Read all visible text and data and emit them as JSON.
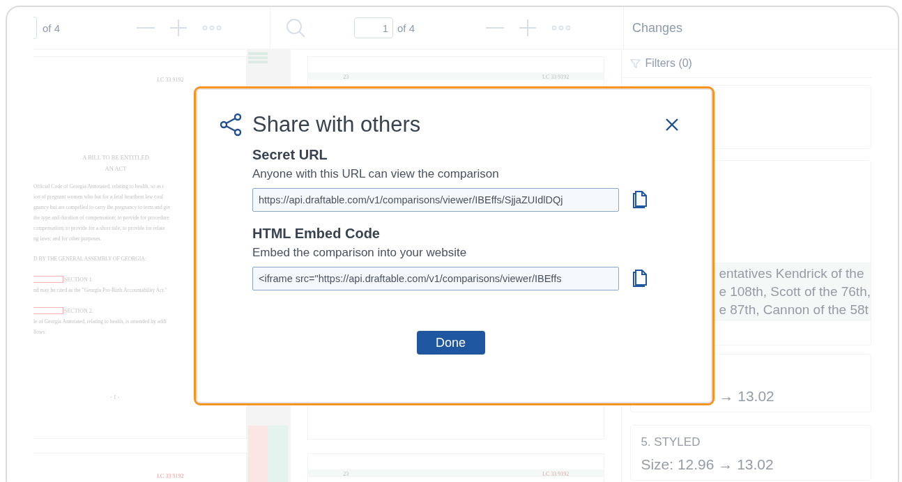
{
  "left_pane": {
    "toolbar": {
      "page_total": "of 4"
    },
    "document": {
      "header_code": "LC 33 9192",
      "title_lines": [
        "A BILL TO BE ENTITLED",
        "AN ACT"
      ],
      "body_lines": [
        {
          "kind": "text",
          "text": "Official Code of Georgia Annotated, relating to health, so as t"
        },
        {
          "kind": "text",
          "text": "ion of pregnant women who but for a fetal heartbeat law coul"
        },
        {
          "kind": "text",
          "text": "gnancy but are compelled to carry the pregnancy to term and giv"
        },
        {
          "kind": "text",
          "text": "the type and duration of compensation; to provide for procedure"
        },
        {
          "kind": "text",
          "text": "compensation; to provide for a short title; to provide for relate"
        },
        {
          "kind": "text",
          "text": "ng laws; and for other purposes."
        },
        {
          "kind": "gap"
        },
        {
          "kind": "text",
          "text": "D BY THE GENERAL ASSEMBLY OF GEORGIA:"
        },
        {
          "kind": "gap"
        },
        {
          "kind": "section",
          "text": "SECTION 1."
        },
        {
          "kind": "text",
          "text": "nd may be cited as the \"Georgia Pro-Birth Accountability Act.\""
        },
        {
          "kind": "gap"
        },
        {
          "kind": "section",
          "text": "SECTION 2."
        },
        {
          "kind": "text",
          "text": "le of Georgia Annotated, relating to health, is amended by addi"
        },
        {
          "kind": "text",
          "text": "llows:"
        }
      ],
      "page_number": "- 1 -"
    },
    "next_page": {
      "header_code": "LC 33 9192"
    }
  },
  "middle_pane": {
    "toolbar": {
      "page_input": "1",
      "page_total": "of 4"
    },
    "document": {
      "line_number": "23",
      "header_code": "LC 33 9192"
    },
    "next_page": {
      "line_number": "23",
      "header_code": "LC 33 9192"
    }
  },
  "changes_panel": {
    "title": "Changes",
    "filters": "Filters (0)",
    "cards": [
      {
        "lines": [
          "entatives Kendrick of the",
          "e 108th, Scott of the 76th,",
          "e 87th, Cannon of the 58t"
        ]
      },
      {
        "lines": [
          "→ 13.02"
        ]
      },
      {
        "heading": "5. STYLED",
        "lines": [
          "Size: 12.96 → 13.02"
        ]
      }
    ]
  },
  "dialog": {
    "title": "Share with others",
    "sections": [
      {
        "heading": "Secret URL",
        "description": "Anyone with this URL can view the comparison",
        "value": "https://api.draftable.com/v1/comparisons/viewer/IBEffs/SjjaZUIdlDQj"
      },
      {
        "heading": "HTML Embed Code",
        "description": "Embed the comparison into your website",
        "value": "<iframe src=\"https://api.draftable.com/v1/comparisons/viewer/IBEffs"
      }
    ],
    "button": "Done"
  }
}
